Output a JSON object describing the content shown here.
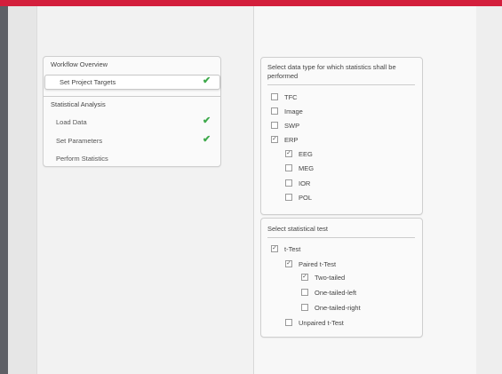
{
  "left_panel": {
    "group1_title": "Workflow Overview",
    "selected_item": "Set Project Targets",
    "group2_title": "Statistical Analysis",
    "items": [
      {
        "label": "Load Data",
        "checked": true
      },
      {
        "label": "Set Parameters",
        "checked": true
      },
      {
        "label": "Perform Statistics",
        "checked": false
      }
    ],
    "check_glyph": "✔",
    "check_color": "#3ea94b"
  },
  "data_type_section": {
    "title": "Select data type for which statistics shall be performed",
    "options": [
      {
        "label": "TFC",
        "checked": false
      },
      {
        "label": "Image",
        "checked": false
      },
      {
        "label": "SWP",
        "checked": false
      },
      {
        "label": "ERP",
        "checked": true
      },
      {
        "label": "EEG",
        "checked": true
      },
      {
        "label": "MEG",
        "checked": false
      },
      {
        "label": "IOR",
        "checked": false
      },
      {
        "label": "POL",
        "checked": false
      }
    ]
  },
  "test_section": {
    "title": "Select statistical test",
    "options": [
      {
        "label": "t-Test",
        "checked": true
      },
      {
        "label": "Paired t-Test",
        "checked": true
      },
      {
        "label": "Two-tailed",
        "checked": true
      },
      {
        "label": "One-tailed-left",
        "checked": false
      },
      {
        "label": "One-tailed-right",
        "checked": false
      },
      {
        "label": "Unpaired t-Test",
        "checked": false
      }
    ]
  },
  "colors": {
    "accent_bar": "#d31f3c",
    "left_rail": "#5e6066"
  }
}
